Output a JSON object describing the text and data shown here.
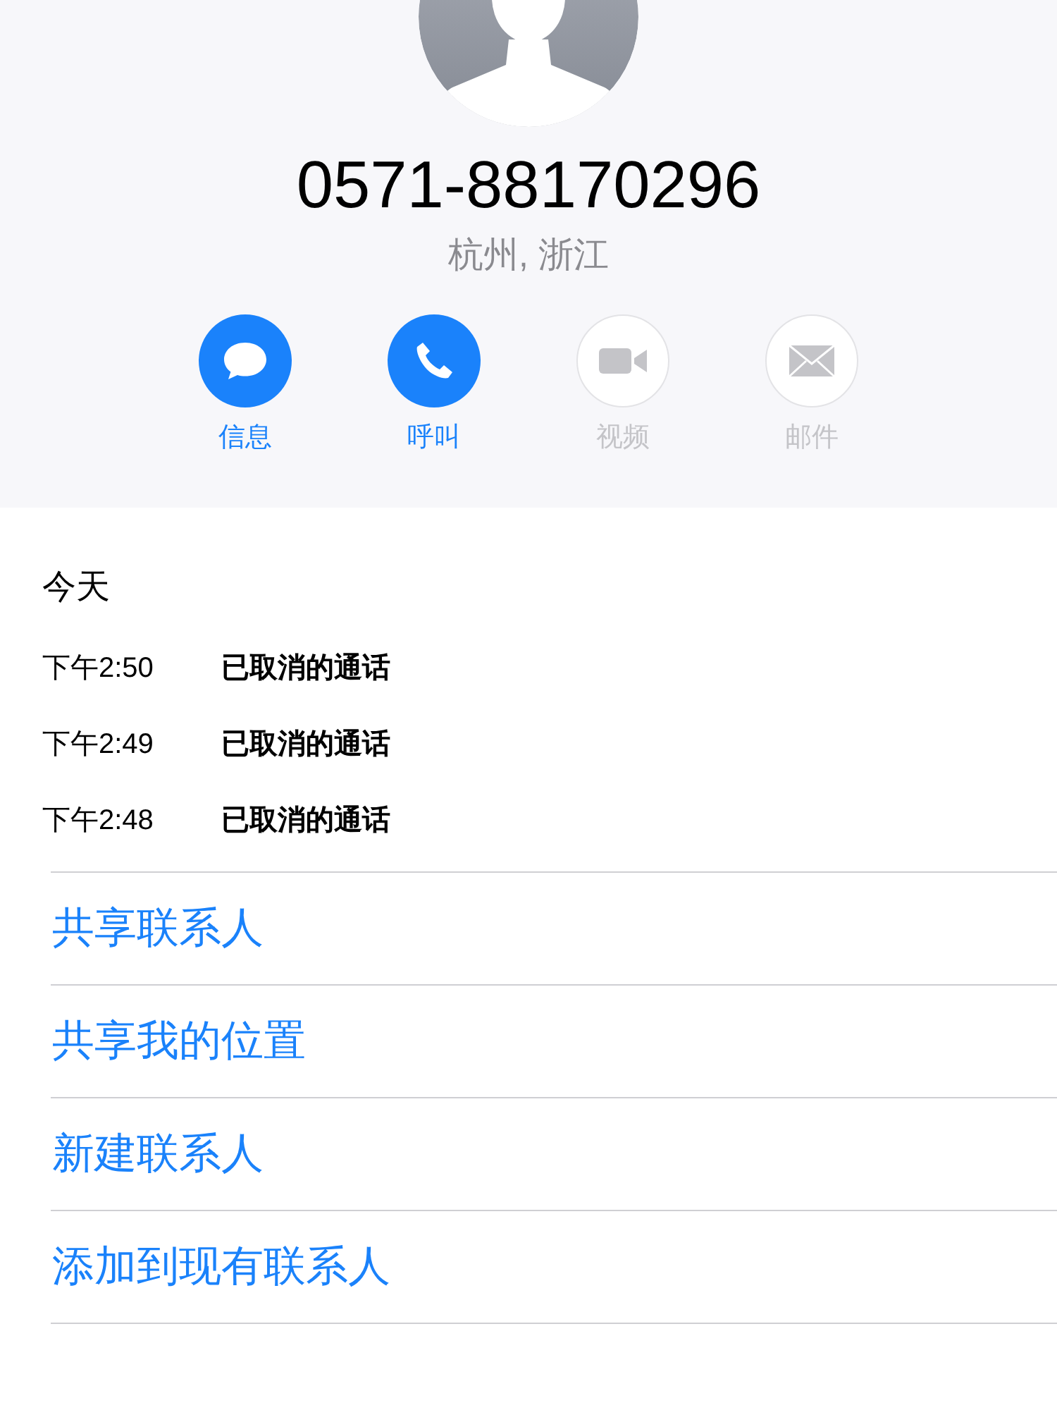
{
  "contact": {
    "phone": "0571-88170296",
    "location": "杭州, 浙江"
  },
  "actions": [
    {
      "kind": "message",
      "label": "信息",
      "disabled": false
    },
    {
      "kind": "call",
      "label": "呼叫",
      "disabled": false
    },
    {
      "kind": "video",
      "label": "视频",
      "disabled": true
    },
    {
      "kind": "mail",
      "label": "邮件",
      "disabled": true
    }
  ],
  "history": {
    "heading": "今天",
    "calls": [
      {
        "time": "下午2:50",
        "status": "已取消的通话"
      },
      {
        "time": "下午2:49",
        "status": "已取消的通话"
      },
      {
        "time": "下午2:48",
        "status": "已取消的通话"
      }
    ]
  },
  "links": [
    "共享联系人",
    "共享我的位置",
    "新建联系人",
    "添加到现有联系人"
  ]
}
